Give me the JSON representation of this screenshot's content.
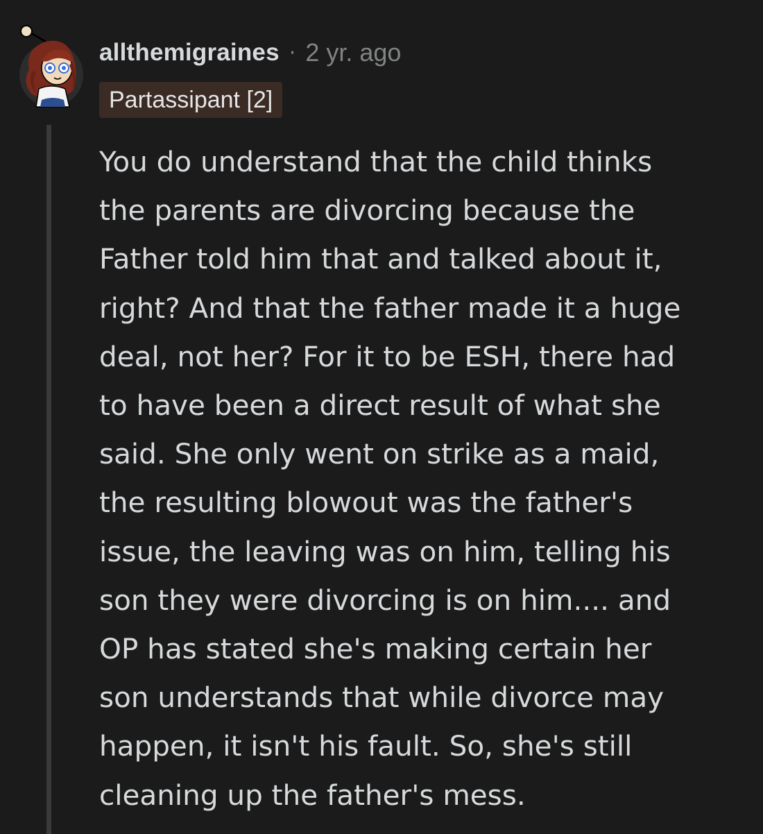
{
  "comment": {
    "username": "allthemigraines",
    "separator": "·",
    "timestamp": "2 yr. ago",
    "flair": "Partassipant [2]",
    "body_lines": [
      "You do understand that the child thinks",
      "the parents are divorcing because the",
      "Father told him that and talked about it,",
      "right? And that the father made it a huge",
      "deal, not her? For it to be ESH, there had",
      "to have been a direct result of what she",
      "said. She only went on strike as a maid,",
      "the resulting blowout was the father's",
      "issue, the leaving was on him, telling his",
      "son they were divorcing is on him.... and",
      "OP has stated she's making certain her",
      "son understands that while divorce may",
      "happen, it isn't his fault. So, she's still",
      "cleaning up the father's mess."
    ]
  },
  "colors": {
    "background": "#1b1b1b",
    "text": "#d7dadc",
    "meta": "#818384",
    "flair_bg": "#3a2b24",
    "thread_line": "#3a3a3a"
  }
}
